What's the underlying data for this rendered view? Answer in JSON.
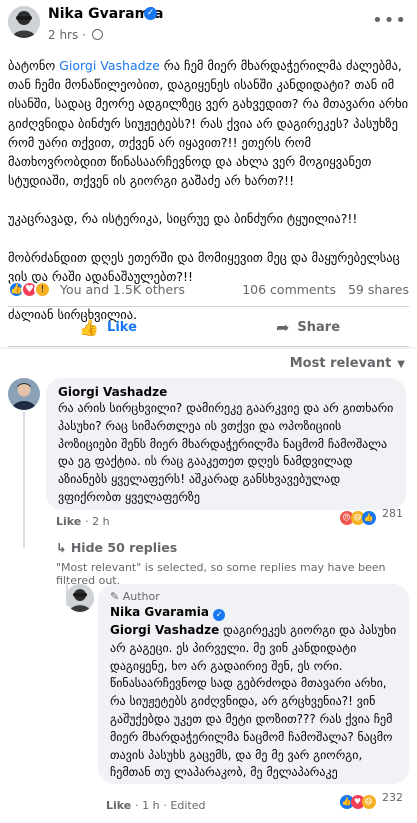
{
  "post": {
    "author": "Nika Gvaramia",
    "time": "2 hrs",
    "paragraphs": [
      {
        "prefix": "ბატონო ",
        "mention": "Giorgi Vashadze",
        "text": " რა ჩემ მიერ მხარდაჭერილმა ძალებმა, თან ჩემი მონაწილეობით, დაგიყენეს ისანში კანდიდატი? თან იმ ისანში, სადაც მეორე ადგილზეც ვერ გახვედით? რა მთავარი არხი გიძღვნიდა ბინძურ სიუჟეტებს?! რას ქვია არ დაგირეკეს? პასუხზე რომ უარი თქვით, თქვენ არ იყავით?!! ეთერს რომ მათხოვრობდით წინასაარჩევნოდ და ახლა ვერ მოგიყვანეთ სტუდიაში, თქვენ ის გიორგი გაშაძე არ ხართ?!!"
      },
      {
        "text": "უკაცრავად, რა ისტერიკა, სიცრუე და ბინძური ტყუილია?!!"
      },
      {
        "text": "მობრძანდით დღეს ეთერში და მომიყევით მეც და მაყურებელსაც ვის და რაში ადანაშაულებთ?!!"
      },
      {
        "text": "ძალიან სირცხვილია."
      }
    ],
    "reactors_label": "You and 1.5K others",
    "comments_count": "106 comments",
    "shares_count": "59 shares",
    "like_label": "Like",
    "share_label": "Share"
  },
  "sort": {
    "label": "Most relevant"
  },
  "comments": [
    {
      "author": "Giorgi Vashadze",
      "text": "რა არის სირცხვილი? დამირეკე გაარკვიე და არ გითხარი პასუხი? რაც სიმართლეა ის ვთქვი და ოპოზიციის პოზიციები შენს მიერ მხარდაჭერილმა ნაცმომ ჩამოშალა და ეგ ფაქტია. ის რაც გააკეთეთ დღეს ნამდვილად აზიანებს ყველაფერს! აშკარად განსხვავებულად ვფიქრობთ ყველაფერზე",
      "like": "Like",
      "time": "2 h",
      "reactions": "281"
    }
  ],
  "replies_toggle": "Hide 50 replies",
  "filter_notice": "\"Most relevant\" is selected, so some replies may have been filtered out.",
  "reply": {
    "badge": "Author",
    "author": "Nika Gvaramia",
    "mention": "Giorgi Vashadze",
    "text": " დაგირეკეს გიორგი და პასუხი არ გაგეცი. ეს პირველი. მე ვინ კანდიდატი დაგიყენე, ხო არ გადაირიე შენ, ეს ორი. წინასაარჩევნოდ სად გებრძოდა მთავარი არხი, რა სიუჟეტებს გიძღვნიდა, არ გრცხვენია?! ვინ გაშუქებდა უკეთ და მეტი დოზით??? რას ქვია ჩემ მიერ მხარდაჭერილმა ნაცმომ ჩამოშალა? ნაცმო თავის პასუხს გაცემს, და მე მე ვარ გიორგი, ჩემთან თუ ლაპარაკობ, მე მელაპარაკე",
    "like": "Like",
    "time": "1 h",
    "edited": "Edited",
    "reactions": "232"
  },
  "icons": [
    "verified-icon",
    "globe-icon",
    "more-icon",
    "like-icon",
    "share-icon",
    "chevron-down-icon",
    "reply-arrow-icon"
  ],
  "colors": {
    "accent": "#1877f2",
    "muted": "#65676b",
    "bubble": "#f0f2f5"
  }
}
